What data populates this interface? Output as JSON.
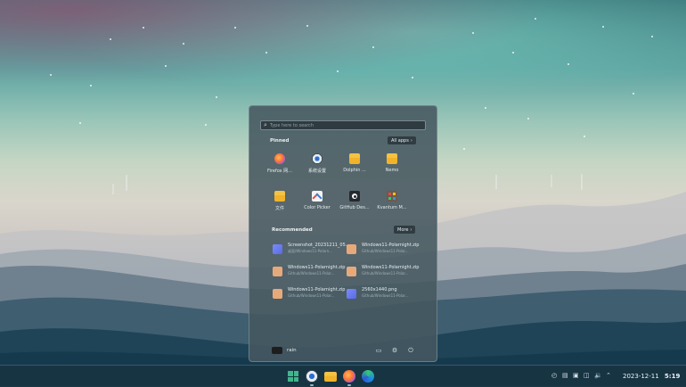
{
  "start_menu": {
    "search_placeholder": "Type here to search",
    "pinned": {
      "title": "Pinned",
      "all_apps_label": "All apps",
      "apps": [
        {
          "label": "Firefox 网...",
          "icon": "firefox-icon"
        },
        {
          "label": "系统设置",
          "icon": "settings-icon"
        },
        {
          "label": "Dolphin ...",
          "icon": "folder-icon"
        },
        {
          "label": "Nemo",
          "icon": "folder-icon"
        },
        {
          "label": "文件",
          "icon": "folder-icon"
        },
        {
          "label": "Color Picker",
          "icon": "color-picker-icon"
        },
        {
          "label": "GitHub Des...",
          "icon": "github-icon"
        },
        {
          "label": "Kvantum M...",
          "icon": "kvantum-icon"
        }
      ]
    },
    "recommended": {
      "title": "Recommended",
      "more_label": "More",
      "items": [
        {
          "name": "Screenshot_20231211_05...",
          "path": "桌面/Windows11-Polarn...",
          "icon": "image-file-icon"
        },
        {
          "name": "Windows11-Polarnight.zip",
          "path": "Github/Windows11-Polar...",
          "icon": "archive-file-icon"
        },
        {
          "name": "Windows11-Polarnight.zip",
          "path": "Github/Windows11-Polar...",
          "icon": "archive-file-icon"
        },
        {
          "name": "Windows11-Polarnight.zip",
          "path": "Github/Windows11-Polar...",
          "icon": "archive-file-icon"
        },
        {
          "name": "Windows11-Polarnight.zip",
          "path": "Github/Windows11-Polar...",
          "icon": "archive-file-icon"
        },
        {
          "name": "2560x1440.png",
          "path": "Github/Windows11-Polar...",
          "icon": "image-file-icon"
        }
      ]
    },
    "user": {
      "name": "rain"
    }
  },
  "taskbar": {
    "date": "2023-12-11",
    "time": "5:19"
  },
  "colors": {
    "accent": "#4a90d9",
    "panel": "#465860",
    "taskbar": "#183442"
  }
}
